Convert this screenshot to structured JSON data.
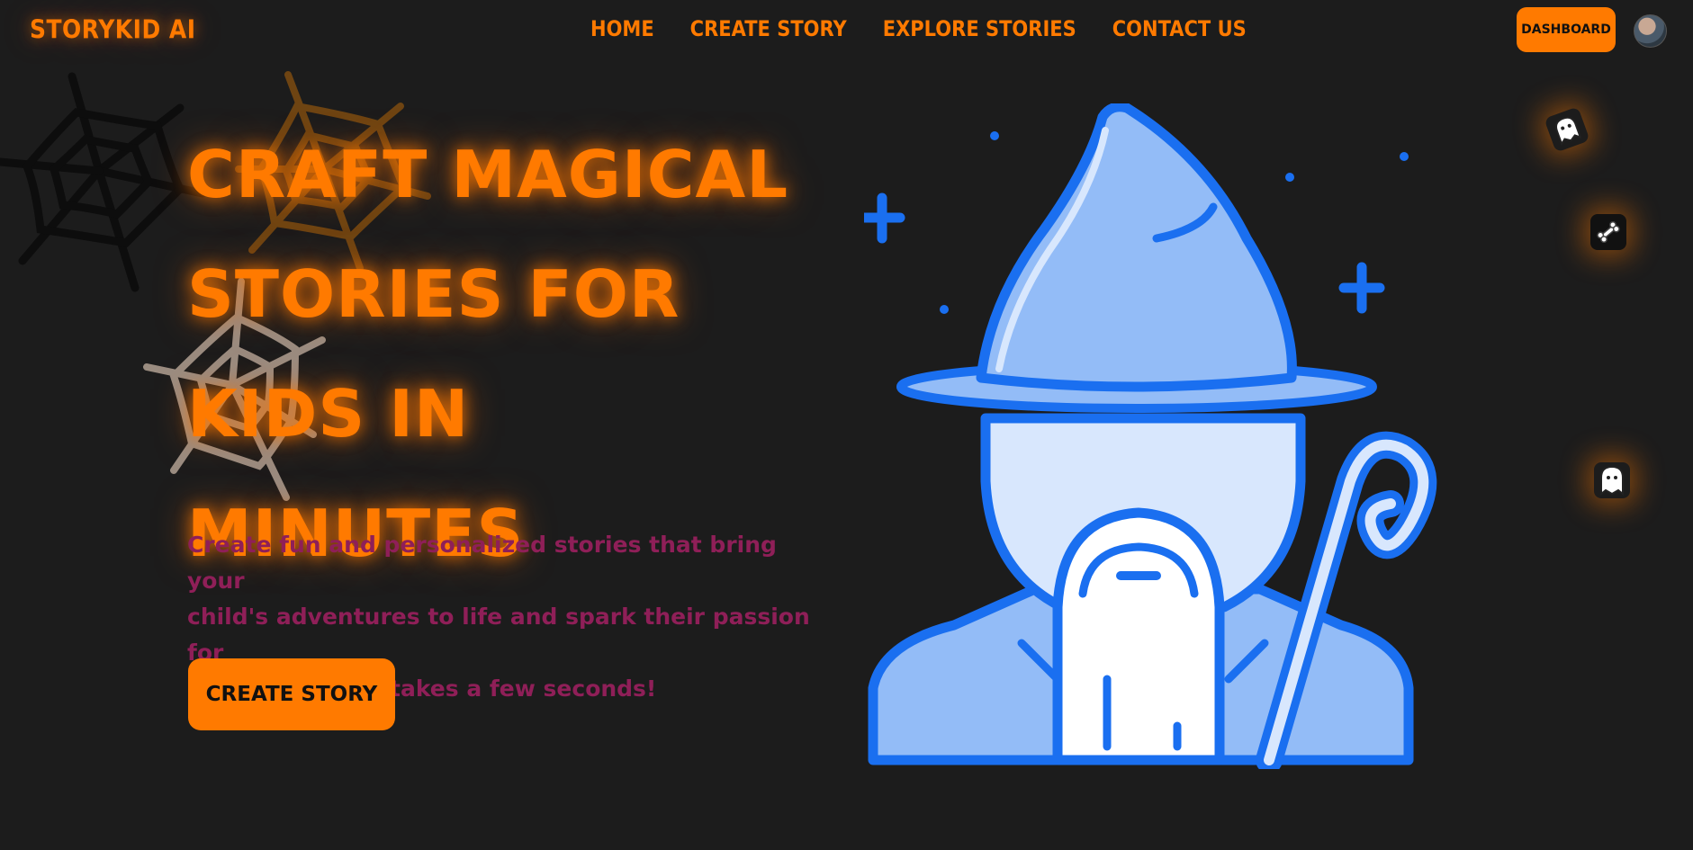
{
  "brand": {
    "name": "STORYKID AI"
  },
  "nav": {
    "items": [
      {
        "label": "HOME"
      },
      {
        "label": "CREATE STORY"
      },
      {
        "label": "EXPLORE STORIES"
      },
      {
        "label": "CONTACT US"
      }
    ]
  },
  "header": {
    "dashboard_label": "DASHBOARD"
  },
  "hero": {
    "title_lines": [
      "CRAFT MAGICAL",
      "STORIES FOR KIDS IN",
      "MINUTES"
    ],
    "subtitle_lines": [
      "Create fun and personalized stories that bring your",
      "child's adventures to life and spark their passion for",
      "reading. It only takes a few seconds!"
    ],
    "cta_label": "CREATE STORY"
  },
  "icons": {
    "webs": [
      "spider-web-icon",
      "spider-web-icon",
      "spider-web-icon"
    ],
    "floating": [
      "ghost-icon",
      "bone-icon",
      "ghost-icon"
    ],
    "illustration": "wizard-illustration"
  },
  "colors": {
    "background": "#1c1c1c",
    "accent": "#ff7a00",
    "subtitle": "#8f1f58",
    "wizard_blue": "#1a6ff0",
    "wizard_light": "#93bcf7"
  }
}
